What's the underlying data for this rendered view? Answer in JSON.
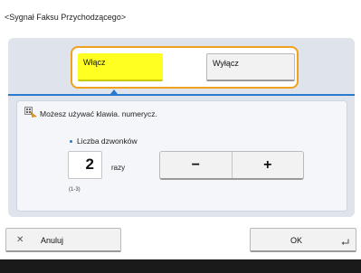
{
  "screen": {
    "title": "<Sygnał Faksu Przychodzącego>"
  },
  "toggle": {
    "on_label": "Włącz",
    "off_label": "Wyłącz",
    "selected": "Włącz",
    "highlight_color": "#ffff22",
    "frame_color": "#f0a21c"
  },
  "hint": {
    "icon": "keypad-hint-icon",
    "text": "Możesz używać klawia. numerycz."
  },
  "rings": {
    "label": "Liczba dzwonków",
    "value": "2",
    "unit": "razy",
    "range": "(1-3)",
    "decrement_label": "−",
    "increment_label": "+"
  },
  "actions": {
    "cancel_icon": "close-icon",
    "cancel_label": "Anuluj",
    "ok_label": "OK",
    "ok_icon": "enter-icon"
  },
  "colors": {
    "accent": "#2a7bd0",
    "panel_bg": "#dfe4ec"
  }
}
